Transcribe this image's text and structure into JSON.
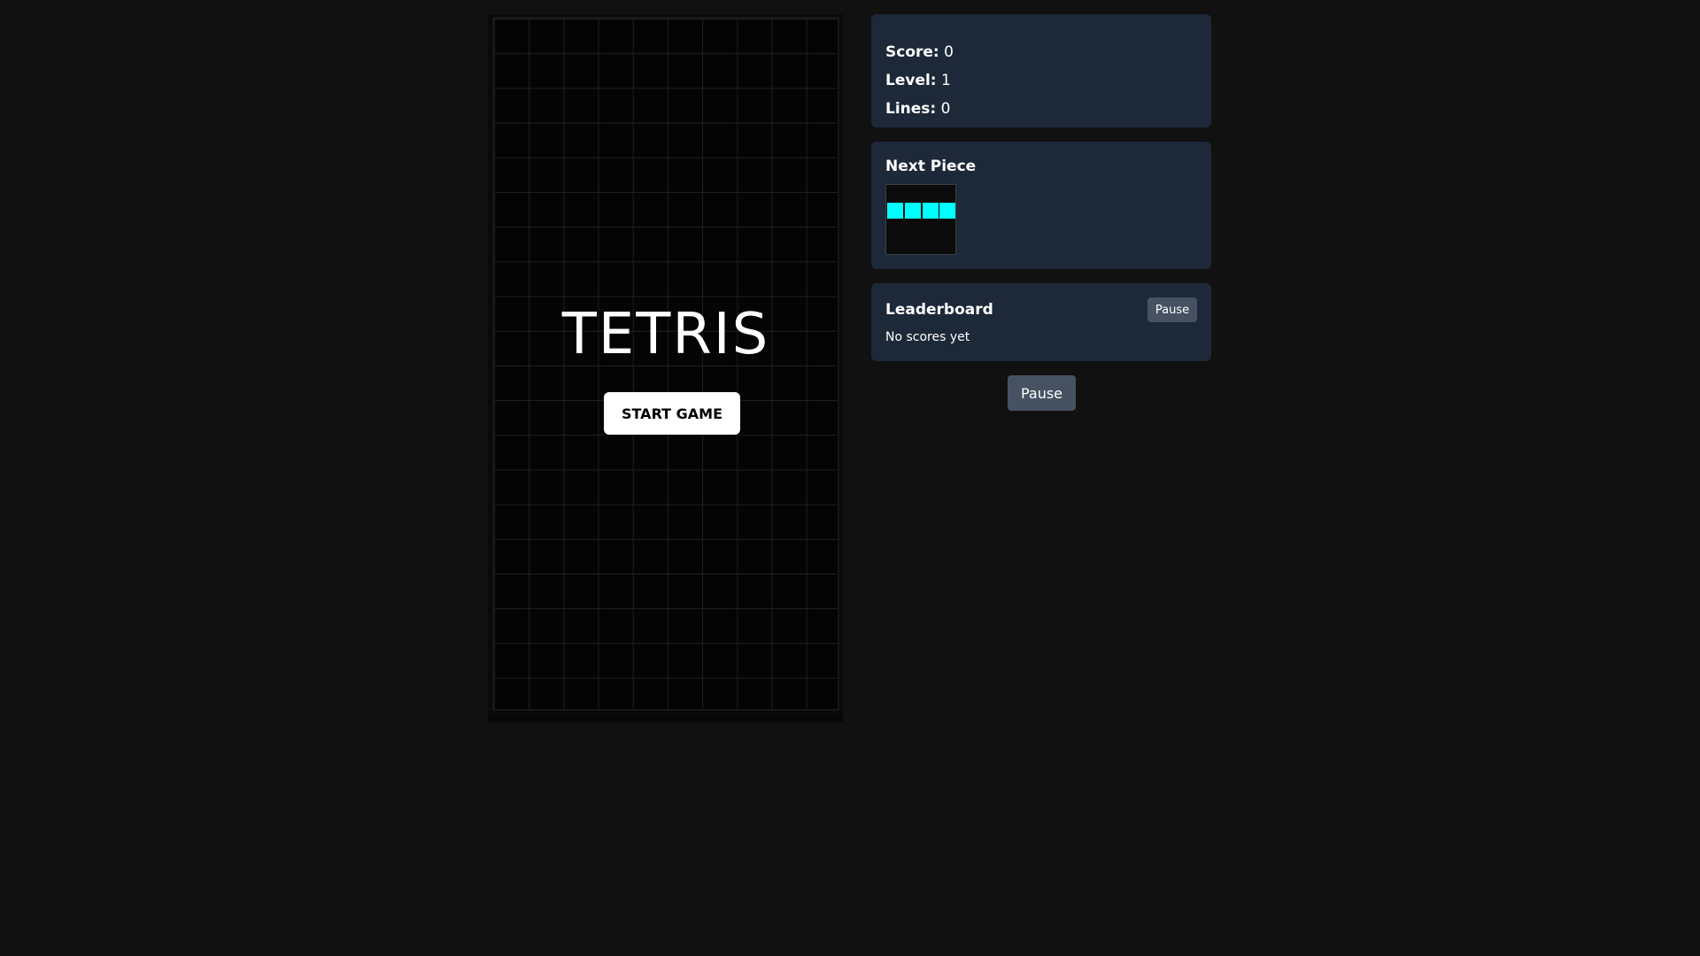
{
  "game": {
    "title": "TETRIS",
    "start_label": "START GAME"
  },
  "stats": {
    "score_label": "Score:",
    "score_value": "0",
    "level_label": "Level:",
    "level_value": "1",
    "lines_label": "Lines:",
    "lines_value": "0"
  },
  "next_piece": {
    "heading": "Next Piece",
    "piece": "I",
    "color": "#00ffff"
  },
  "leaderboard": {
    "heading": "Leaderboard",
    "pause_label": "Pause",
    "empty_text": "No scores yet"
  },
  "controls": {
    "pause_label": "Pause"
  },
  "colors": {
    "background": "#111111",
    "panel": "#1d2838",
    "button": "#465261",
    "piece_i": "#00ffff"
  }
}
